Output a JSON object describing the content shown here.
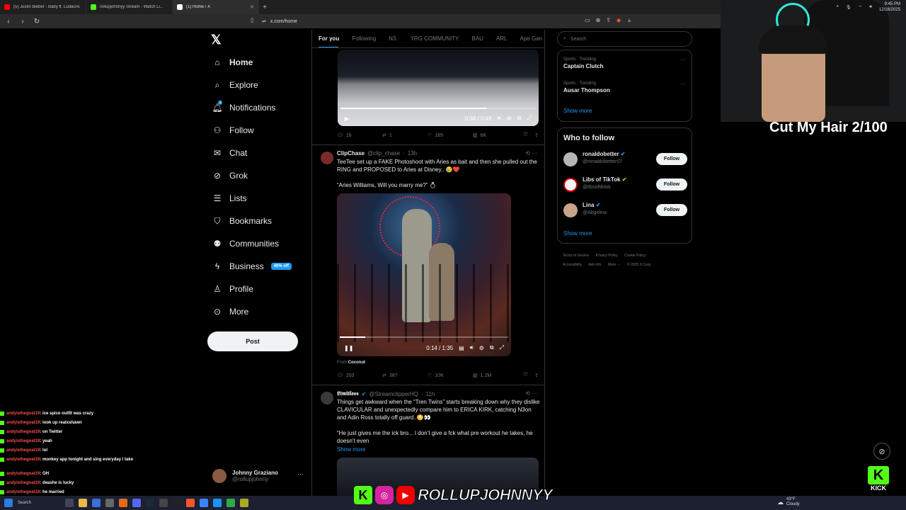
{
  "browser": {
    "tabs": [
      {
        "title": "(5) Justin Bieber - Baby ft. Ludacris",
        "color": "#ff0000"
      },
      {
        "title": "rollupjohnnyy Stream - Watch Li...",
        "color": "#53fc18"
      },
      {
        "title": "(1) Home / X",
        "color": "#ffffff"
      }
    ],
    "url": "x.com/home"
  },
  "nav": {
    "items": [
      {
        "label": "Home",
        "icon": "home-icon"
      },
      {
        "label": "Explore",
        "icon": "search-icon"
      },
      {
        "label": "Notifications",
        "icon": "bell-icon"
      },
      {
        "label": "Follow",
        "icon": "person-add-icon"
      },
      {
        "label": "Chat",
        "icon": "mail-icon"
      },
      {
        "label": "Grok",
        "icon": "grok-icon"
      },
      {
        "label": "Lists",
        "icon": "list-icon"
      },
      {
        "label": "Bookmarks",
        "icon": "bookmark-icon"
      },
      {
        "label": "Communities",
        "icon": "people-icon"
      },
      {
        "label": "Business",
        "icon": "bolt-icon"
      },
      {
        "label": "Profile",
        "icon": "profile-icon"
      },
      {
        "label": "More",
        "icon": "more-circle-icon"
      }
    ],
    "notif_badge": "1",
    "business_badge": "40% off",
    "post_label": "Post",
    "account": {
      "name": "Johnny Graziano",
      "handle": "@rollupjohnny"
    }
  },
  "timeline": {
    "tabs": [
      "For you",
      "Following",
      "N3.",
      "YRG COMMUNITY",
      "BAU",
      "ARL",
      "Ape Gan"
    ],
    "top_video": {
      "time": "0:36 / 0:48",
      "progress": 0.75
    },
    "top_actions": {
      "replies": "16",
      "reposts": "1",
      "likes": "185",
      "views": "6K"
    },
    "tweet1": {
      "name": "ClipChase",
      "handle": "@clip_chase",
      "time": "13h",
      "text": "TeeTee set up a FAKE Photoshoot with Aries as bait and then she pulled out the RING and PROPOSED to Aries at Disney.. 😢❤️",
      "quote": "“Aries Williams, Will you marry me?” 💍",
      "video_time": "0:14 / 1:35",
      "progress": 0.15,
      "from_label": "From",
      "from_source": "Coconut",
      "replies": "203",
      "reposts": "387",
      "likes": "10K",
      "views": "1.2M"
    },
    "tweet2": {
      "name": "𝕷𝖎𝖒𝖎𝖙𝖑𝖊𝖘𝖘",
      "handle": "@StreamclipperHQ",
      "time": "11h",
      "text": "Things get awkward when the “Tren Twins” starts breaking down why they dislike CLAVICULAR and unexpectedly compare him to ERICA KIRK, catching N3on and Adin Ross totally off guard..😳👀",
      "quote": "“He just gives me the ick bro... I don’t give a fck what pre workout he takes, he doesn’t even",
      "show_more": "Show more"
    }
  },
  "sidebar": {
    "search_placeholder": "Search",
    "trends": [
      {
        "category": "Sports · Trending",
        "title": "Captain Clutch"
      },
      {
        "category": "Sports · Trending",
        "title": "Ausar Thompson"
      }
    ],
    "show_more": "Show more",
    "who_to_follow_title": "Who to follow",
    "suggestions": [
      {
        "name": "ronaldobetter",
        "handle": "@ronaldobetter07",
        "follow": "Follow",
        "badge": "blue"
      },
      {
        "name": "Libs of TikTok",
        "handle": "@libsoftiktok",
        "follow": "Follow",
        "badge": "gold"
      },
      {
        "name": "Lina",
        "handle": "@Abgxlina",
        "follow": "Follow",
        "badge": "blue"
      }
    ],
    "show_more2": "Show more",
    "footer": [
      "Terms of Service",
      "Privacy Policy",
      "Cookie Policy",
      "Accessibility",
      "Ads info",
      "More ···",
      "© 2025 X Corp."
    ]
  },
  "overlay": {
    "title": "Cut My Hair 2/100",
    "brand": "ROLLUPJOHNNYY",
    "kick": "KICK"
  },
  "chat": [
    {
      "user": "andyisthegoat19",
      "msg": ": ice spice outfit was crazy"
    },
    {
      "user": "andyisthegoat19",
      "msg": ": look up realxshawn"
    },
    {
      "user": "andyisthegoat19",
      "msg": ": on Twitter"
    },
    {
      "user": "andyisthegoat19",
      "msg": ": yeah"
    },
    {
      "user": "andyisthegoat19",
      "msg": ": lol"
    },
    {
      "user": "andyisthegoat19",
      "msg": ": monkey app tonight and sing everyday I take"
    },
    {
      "user": "andyisthegoat19",
      "msg": ": OH"
    },
    {
      "user": "andyisthegoat19",
      "msg": ": deashe is lucky"
    },
    {
      "user": "andyisthegoat19",
      "msg": ": he married"
    }
  ],
  "taskbar": {
    "search": "Search",
    "weather_temp": "43°F",
    "weather_desc": "Cloudy",
    "time": "9:45 PM",
    "date": "12/18/2025"
  }
}
